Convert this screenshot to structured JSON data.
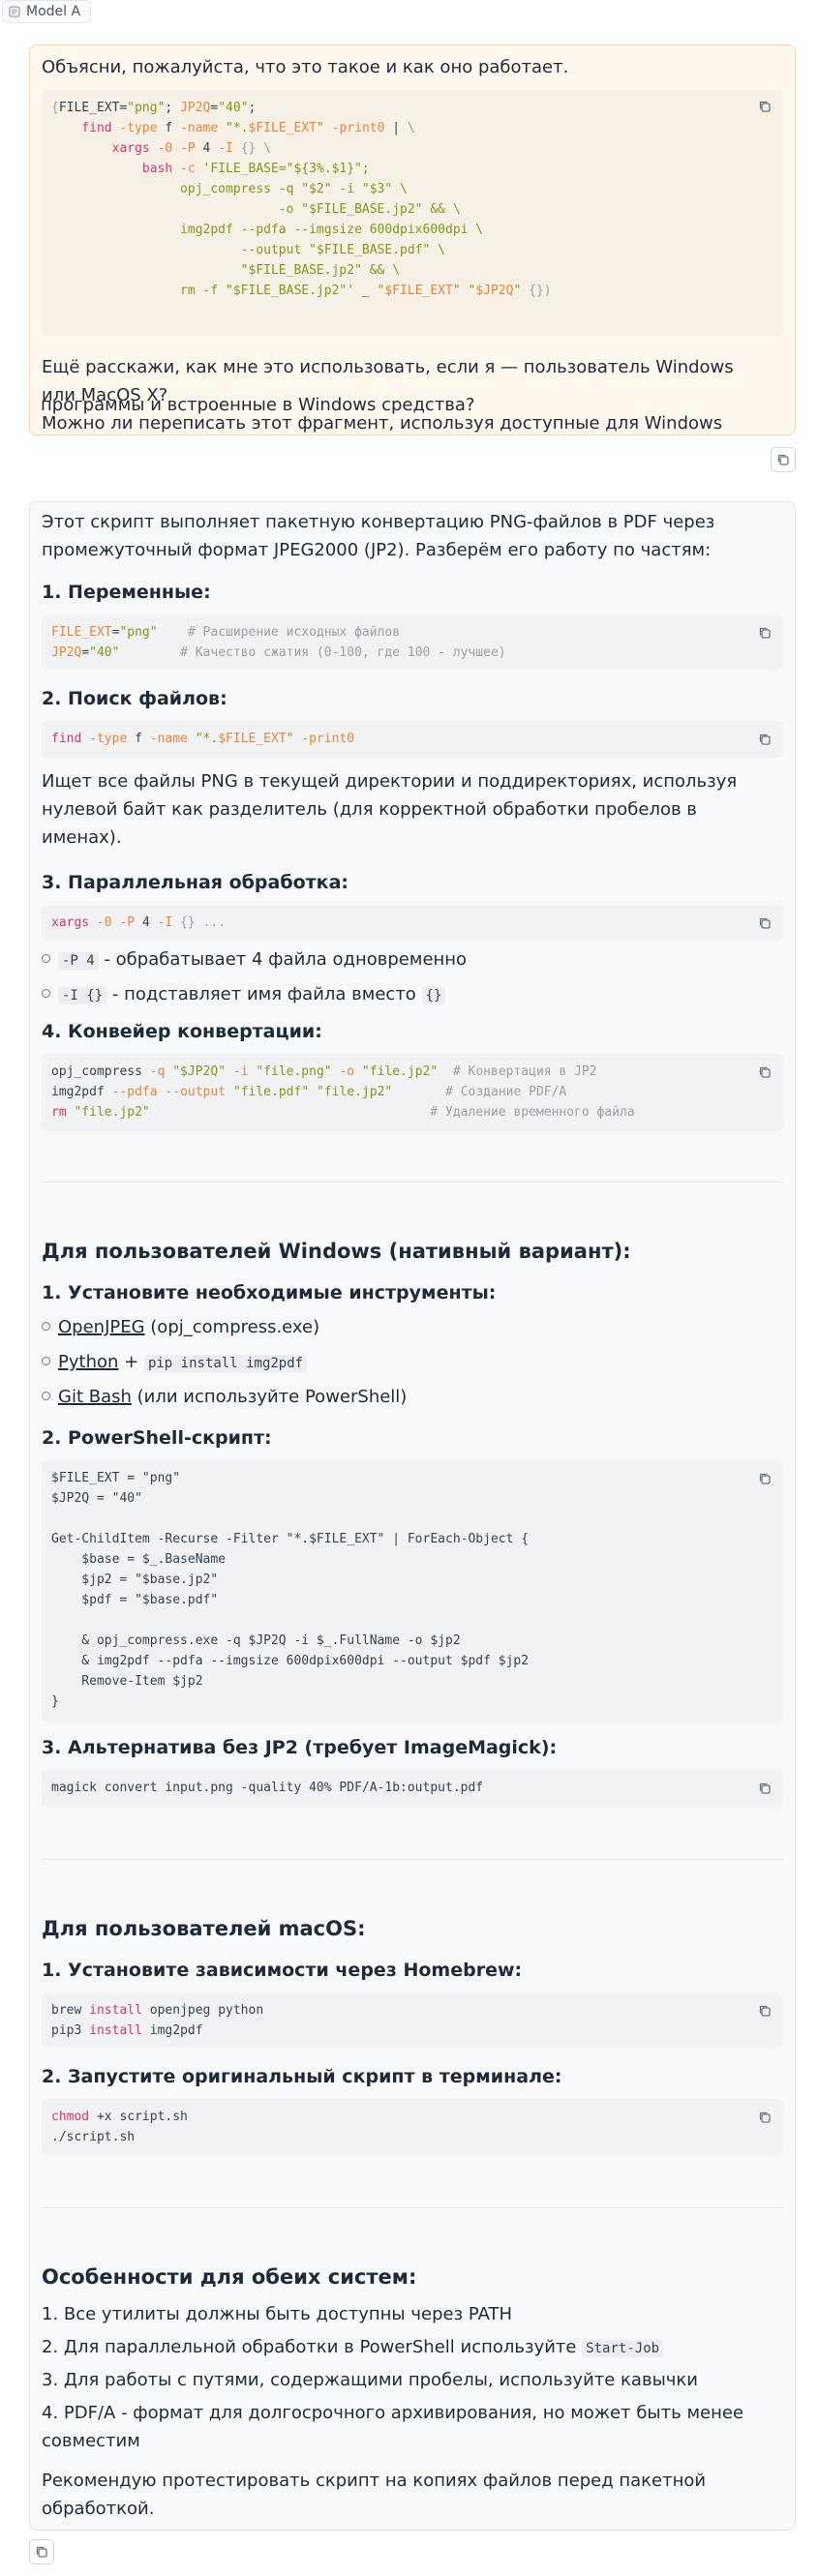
{
  "model_tag": "Model A",
  "user": {
    "line1": "Объясни, пожалуйста, что это такое и как оно работает.",
    "code": [
      [
        {
          "t": "{",
          "c": "gray"
        },
        {
          "t": "FILE_EXT",
          "c": "plain"
        },
        {
          "t": "=",
          "c": "plain"
        },
        {
          "t": "\"png\"",
          "c": "green"
        },
        {
          "t": "; ",
          "c": "plain"
        },
        {
          "t": "JP2Q",
          "c": "orange"
        },
        {
          "t": "=",
          "c": "plain"
        },
        {
          "t": "\"40\"",
          "c": "green"
        },
        {
          "t": ";",
          "c": "plain"
        }
      ],
      [
        {
          "t": "    find ",
          "c": "pink"
        },
        {
          "t": "-type ",
          "c": "orange"
        },
        {
          "t": "f ",
          "c": "plain"
        },
        {
          "t": "-name ",
          "c": "orange"
        },
        {
          "t": "\"*.",
          "c": "green"
        },
        {
          "t": "$FILE_EXT",
          "c": "orange"
        },
        {
          "t": "\" ",
          "c": "green"
        },
        {
          "t": "-print0 ",
          "c": "orange"
        },
        {
          "t": "| ",
          "c": "plain"
        },
        {
          "t": "\\",
          "c": "gray"
        }
      ],
      [
        {
          "t": "        xargs ",
          "c": "pink"
        },
        {
          "t": "-0 ",
          "c": "orange"
        },
        {
          "t": "-P ",
          "c": "orange"
        },
        {
          "t": "4 ",
          "c": "plain"
        },
        {
          "t": "-I ",
          "c": "orange"
        },
        {
          "t": "{} \\",
          "c": "gray"
        }
      ],
      [
        {
          "t": "            bash ",
          "c": "pink"
        },
        {
          "t": "-c ",
          "c": "orange"
        },
        {
          "t": "'FILE_BASE=\"${3%.$1}\";",
          "c": "green"
        }
      ],
      [
        {
          "t": "                 opj_compress -q \"$2\" -i \"$3\" \\",
          "c": "green"
        }
      ],
      [
        {
          "t": "                              -o \"$FILE_BASE.jp2\" && \\",
          "c": "green"
        }
      ],
      [
        {
          "t": "                 img2pdf --pdfa --imgsize 600dpix600dpi \\",
          "c": "green"
        }
      ],
      [
        {
          "t": "                         --output \"$FILE_BASE.pdf\" \\",
          "c": "green"
        }
      ],
      [
        {
          "t": "                         \"$FILE_BASE.jp2\" && \\",
          "c": "green"
        }
      ],
      [
        {
          "t": "                 rm -f \"$FILE_BASE.jp2\"' ",
          "c": "green"
        },
        {
          "t": "_ ",
          "c": "plain"
        },
        {
          "t": "\"",
          "c": "green"
        },
        {
          "t": "$FILE_EXT",
          "c": "orange"
        },
        {
          "t": "\" \"",
          "c": "green"
        },
        {
          "t": "$JP2Q",
          "c": "orange"
        },
        {
          "t": "\" ",
          "c": "green"
        },
        {
          "t": "{})",
          "c": "gray"
        }
      ]
    ],
    "para": [
      "Ещё расскажи, как мне это использовать, если я — пользователь Windows",
      "или MacOS X?",
      "Можно ли переписать этот фрагмент, используя доступные для Windows",
      "программы и встроенные в Windows средства?"
    ]
  },
  "assistant": {
    "intro": [
      "Этот скрипт выполняет пакетную конвертацию PNG-файлов в PDF через",
      "промежуточный формат JPEG2000 (JP2). Разберём его работу по частям:"
    ],
    "h_vars": "1. Переменные:",
    "code_vars": [
      [
        {
          "t": "FILE_EXT",
          "c": "orange"
        },
        {
          "t": "=",
          "c": "plain"
        },
        {
          "t": "\"png\"",
          "c": "green"
        },
        {
          "t": "    # Расширение исходных файлов",
          "c": "gray"
        }
      ],
      [
        {
          "t": "JP2Q",
          "c": "orange"
        },
        {
          "t": "=",
          "c": "plain"
        },
        {
          "t": "\"40\"",
          "c": "green"
        },
        {
          "t": "        # Качество сжатия (0-100, где 100 - лучшее)",
          "c": "gray"
        }
      ]
    ],
    "h_find": "2. Поиск файлов:",
    "code_find": [
      [
        {
          "t": "find ",
          "c": "pink"
        },
        {
          "t": "-type ",
          "c": "orange"
        },
        {
          "t": "f ",
          "c": "plain"
        },
        {
          "t": "-name ",
          "c": "orange"
        },
        {
          "t": "\"*.",
          "c": "green"
        },
        {
          "t": "$FILE_EXT",
          "c": "orange"
        },
        {
          "t": "\" ",
          "c": "green"
        },
        {
          "t": "-print0",
          "c": "orange"
        }
      ]
    ],
    "find_desc": [
      "Ищет все файлы PNG в текущей директории и поддиректориях, используя",
      "нулевой байт как разделитель (для корректной обработки пробелов в",
      "именах)."
    ],
    "h_parallel": "3. Параллельная обработка:",
    "code_parallel": [
      [
        {
          "t": "xargs ",
          "c": "pink"
        },
        {
          "t": "-0 ",
          "c": "orange"
        },
        {
          "t": "-P ",
          "c": "orange"
        },
        {
          "t": "4 ",
          "c": "plain"
        },
        {
          "t": "-I ",
          "c": "orange"
        },
        {
          "t": "{} ...",
          "c": "gray"
        }
      ]
    ],
    "par_b1_code": "-P 4",
    "par_b1_text": " - обрабатывает 4 файла одновременно",
    "par_b2_code": "-I {}",
    "par_b2_text": " - подставляет имя файла вместо ",
    "par_b2_code2": "{}",
    "h_pipeline": "4. Конвейер конвертации:",
    "code_pipeline": [
      [
        {
          "t": "opj_compress ",
          "c": "plain"
        },
        {
          "t": "-q ",
          "c": "orange"
        },
        {
          "t": "\"$JP2Q\" ",
          "c": "green"
        },
        {
          "t": "-i ",
          "c": "orange"
        },
        {
          "t": "\"file.png\" ",
          "c": "green"
        },
        {
          "t": "-o ",
          "c": "orange"
        },
        {
          "t": "\"file.jp2\"",
          "c": "green"
        },
        {
          "t": "  # Конвертация в JP2",
          "c": "gray"
        }
      ],
      [
        {
          "t": "img2pdf ",
          "c": "plain"
        },
        {
          "t": "--pdfa ",
          "c": "orange"
        },
        {
          "t": "--output ",
          "c": "orange"
        },
        {
          "t": "\"file.pdf\" \"file.jp2\"",
          "c": "green"
        },
        {
          "t": "       # Создание PDF/A",
          "c": "gray"
        }
      ],
      [
        {
          "t": "rm ",
          "c": "red"
        },
        {
          "t": "\"file.jp2\"",
          "c": "green"
        },
        {
          "t": "                                     # Удаление временного файла",
          "c": "gray"
        }
      ]
    ],
    "h_windows": "Для пользователей Windows (нативный вариант):",
    "h_install": "1. Установите необходимые инструменты:",
    "win_b1_link": "OpenJPEG",
    "win_b1_text": " (opj_compress.exe)",
    "win_b2_link": "Python",
    "win_b2_text": " + ",
    "win_b2_code": "pip install img2pdf",
    "win_b3_link": "Git Bash",
    "win_b3_text": " (или используйте PowerShell)",
    "h_ps": "2. PowerShell-скрипт:",
    "code_ps": [
      [
        {
          "t": "$FILE_EXT = \"png\"",
          "c": "plain"
        }
      ],
      [
        {
          "t": "$JP2Q = \"40\"",
          "c": "plain"
        }
      ],
      [
        {
          "t": "",
          "c": "plain"
        }
      ],
      [
        {
          "t": "Get-ChildItem -Recurse -Filter \"*.$FILE_EXT\" | ForEach-Object {",
          "c": "plain"
        }
      ],
      [
        {
          "t": "    $base = $_.BaseName",
          "c": "plain"
        }
      ],
      [
        {
          "t": "    $jp2 = \"$base.jp2\"",
          "c": "plain"
        }
      ],
      [
        {
          "t": "    $pdf = \"$base.pdf\"",
          "c": "plain"
        }
      ],
      [
        {
          "t": "",
          "c": "plain"
        }
      ],
      [
        {
          "t": "    & opj_compress.exe -q $JP2Q -i $_.FullName -o $jp2",
          "c": "plain"
        }
      ],
      [
        {
          "t": "    & img2pdf --pdfa --imgsize 600dpix600dpi --output $pdf $jp2",
          "c": "plain"
        }
      ],
      [
        {
          "t": "    Remove-Item $jp2",
          "c": "plain"
        }
      ],
      [
        {
          "t": "}",
          "c": "plain"
        }
      ]
    ],
    "h_alt": "3. Альтернатива без JP2 (требует ImageMagick):",
    "code_alt": [
      [
        {
          "t": "magick convert input.png -quality 40% PDF/A-1b:output.pdf",
          "c": "plain"
        }
      ]
    ],
    "h_mac": "Для пользователей macOS:",
    "h_brew": "1. Установите зависимости через Homebrew:",
    "code_brew": [
      [
        {
          "t": "brew ",
          "c": "plain"
        },
        {
          "t": "install ",
          "c": "pink"
        },
        {
          "t": "openjpeg python",
          "c": "plain"
        }
      ],
      [
        {
          "t": "pip3 ",
          "c": "plain"
        },
        {
          "t": "install ",
          "c": "pink"
        },
        {
          "t": "img2pdf",
          "c": "plain"
        }
      ]
    ],
    "h_run": "2. Запустите оригинальный скрипт в терминале:",
    "code_run": [
      [
        {
          "t": "chmod ",
          "c": "pink"
        },
        {
          "t": "+x script.sh",
          "c": "plain"
        }
      ],
      [
        {
          "t": "./script.sh",
          "c": "plain"
        }
      ]
    ],
    "h_features": "Особенности для обеих систем:",
    "feat1": "1. Все утилиты должны быть доступны через PATH",
    "feat2_text": "2. Для параллельной обработки в PowerShell используйте ",
    "feat2_code": "Start-Job",
    "feat3": "3. Для работы с путями, содержащими пробелы, используйте кавычки",
    "feat4a": "4. PDF/A - формат для долгосрочного архивирования, но может быть менее",
    "feat4b": "совместим",
    "outro": [
      "Рекомендую протестировать скрипт на копиях файлов перед пакетной",
      "обработкой."
    ]
  },
  "colors": {
    "user_bg": "#fff8ef",
    "user_border": "#f4d7aa",
    "code_pink": "#d6336c",
    "code_orange": "#e8833a",
    "code_green": "#7f9a1a",
    "code_gray": "#9aa0a6"
  },
  "icons": [
    "copy-icon",
    "model-icon"
  ]
}
